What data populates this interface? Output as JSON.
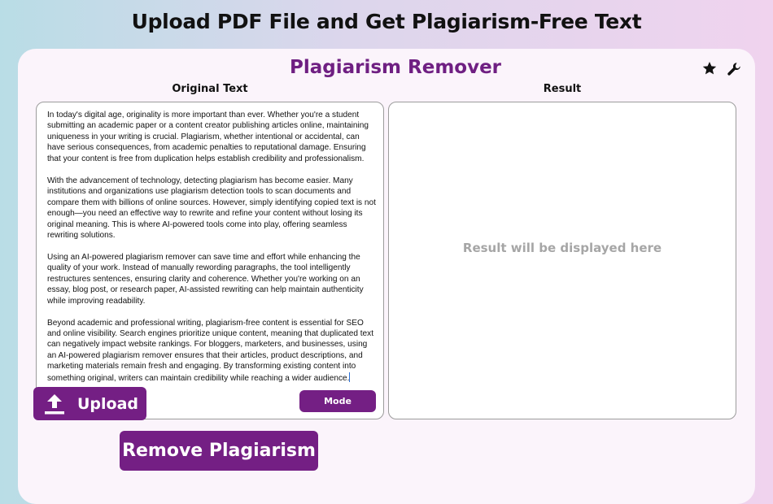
{
  "page": {
    "headline": "Upload PDF File and Get Plagiarism-Free Text"
  },
  "app": {
    "title": "Plagiarism Remover",
    "icons": [
      "star-icon",
      "wrench-icon"
    ]
  },
  "original": {
    "label": "Original Text",
    "paragraphs": [
      "In today's digital age, originality is more important than ever. Whether you're a student submitting an academic paper or a content creator publishing articles online, maintaining uniqueness in your writing is crucial. Plagiarism, whether intentional or accidental, can have serious consequences, from academic penalties to reputational damage. Ensuring that your content is free from duplication helps establish credibility and professionalism.",
      "With the advancement of technology, detecting plagiarism has become easier. Many institutions and organizations use plagiarism detection tools to scan documents and compare them with billions of online sources. However, simply identifying copied text is not enough—you need an effective way to rewrite and refine your content without losing its original meaning. This is where AI-powered tools come into play, offering seamless rewriting solutions.",
      "Using an AI-powered plagiarism remover can save time and effort while enhancing the quality of your work. Instead of manually rewording paragraphs, the tool intelligently restructures sentences, ensuring clarity and coherence. Whether you're working on an essay, blog post, or research paper, AI-assisted rewriting can help maintain authenticity while improving readability.",
      "Beyond academic and professional writing, plagiarism-free content is essential for SEO and online visibility. Search engines prioritize unique content, meaning that duplicated text can negatively impact website rankings. For bloggers, marketers, and businesses, using an AI-powered plagiarism remover ensures that their articles, product descriptions, and marketing materials remain fresh and engaging. By transforming existing content into something original, writers can maintain credibility while reaching a wider audience."
    ],
    "mode_label": "Mode"
  },
  "result": {
    "label": "Result",
    "placeholder": "Result will be displayed here"
  },
  "actions": {
    "upload_label": "Upload",
    "remove_label": "Remove Plagiarism"
  },
  "colors": {
    "accent": "#741f84",
    "title": "#6f1f82",
    "placeholder": "#a6a6a6"
  }
}
